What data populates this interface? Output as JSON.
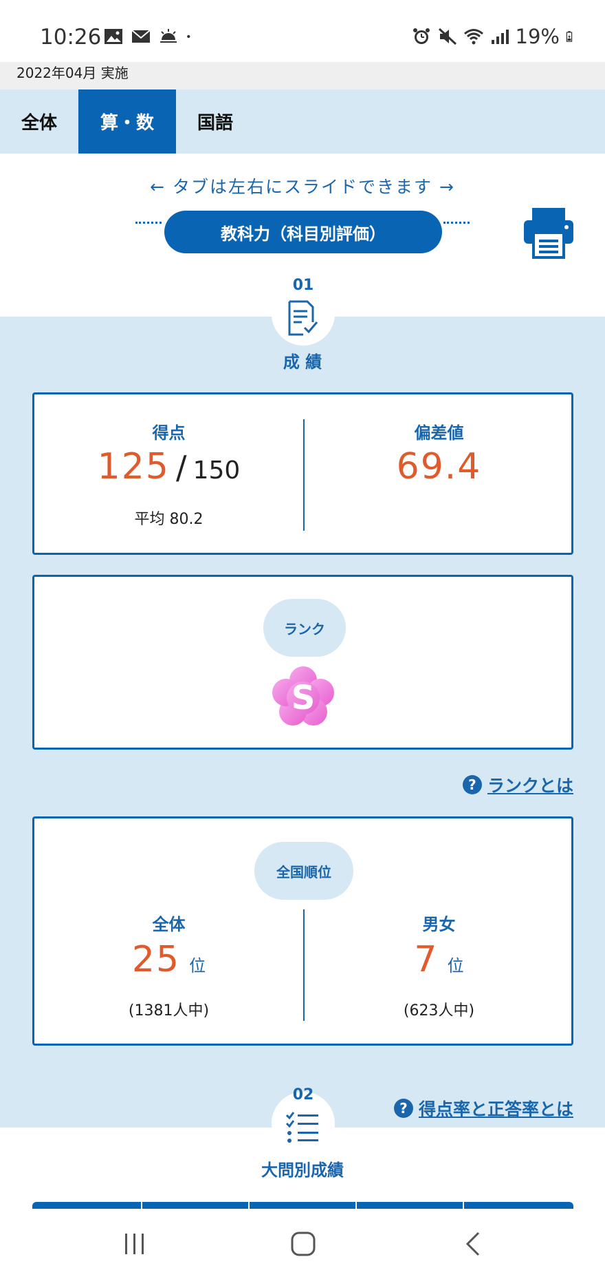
{
  "status_bar": {
    "time": "10:26",
    "battery": "19%",
    "left_icons": [
      "gallery-icon",
      "mail-icon",
      "weather-icon",
      "dot-icon"
    ],
    "right_icons": [
      "alarm-icon",
      "mute-icon",
      "wifi-icon",
      "signal-icon",
      "battery-icon"
    ]
  },
  "header": {
    "date": "2022年04月 実施"
  },
  "tabs": [
    {
      "label": "全体"
    },
    {
      "label": "算・数"
    },
    {
      "label": "国語"
    }
  ],
  "active_tab": "算・数",
  "slide_hint": {
    "left_arrow": "←",
    "text": "タブは左右にスライドできます",
    "right_arrow": "→"
  },
  "section_title": "教科力（科目別評価）",
  "sections": [
    {
      "number": "01",
      "label": "成 績"
    },
    {
      "number": "02",
      "label": "大問別成績"
    }
  ],
  "score": {
    "label": "得点",
    "value": "125",
    "slash": "/",
    "max": "150",
    "average_text": "平均 80.2"
  },
  "deviation": {
    "label": "偏差値",
    "value": "69.4"
  },
  "rank": {
    "label": "ランク",
    "value": "S"
  },
  "links": {
    "rank_help": "ランクとは",
    "score_rate_help": "得点率と正答率とは",
    "qmark": "?"
  },
  "national_rank": {
    "label": "全国順位",
    "overall": {
      "label": "全体",
      "value": "25",
      "unit": "位",
      "total": "(1381人中)"
    },
    "gender": {
      "label": "男女",
      "value": "7",
      "unit": "位",
      "total": "(623人中)"
    }
  },
  "colors": {
    "primary": "#0a64b4",
    "light_blue": "#d6e8f4",
    "accent_orange": "#e05a2c",
    "rank_pink": "#ee7fd8"
  }
}
